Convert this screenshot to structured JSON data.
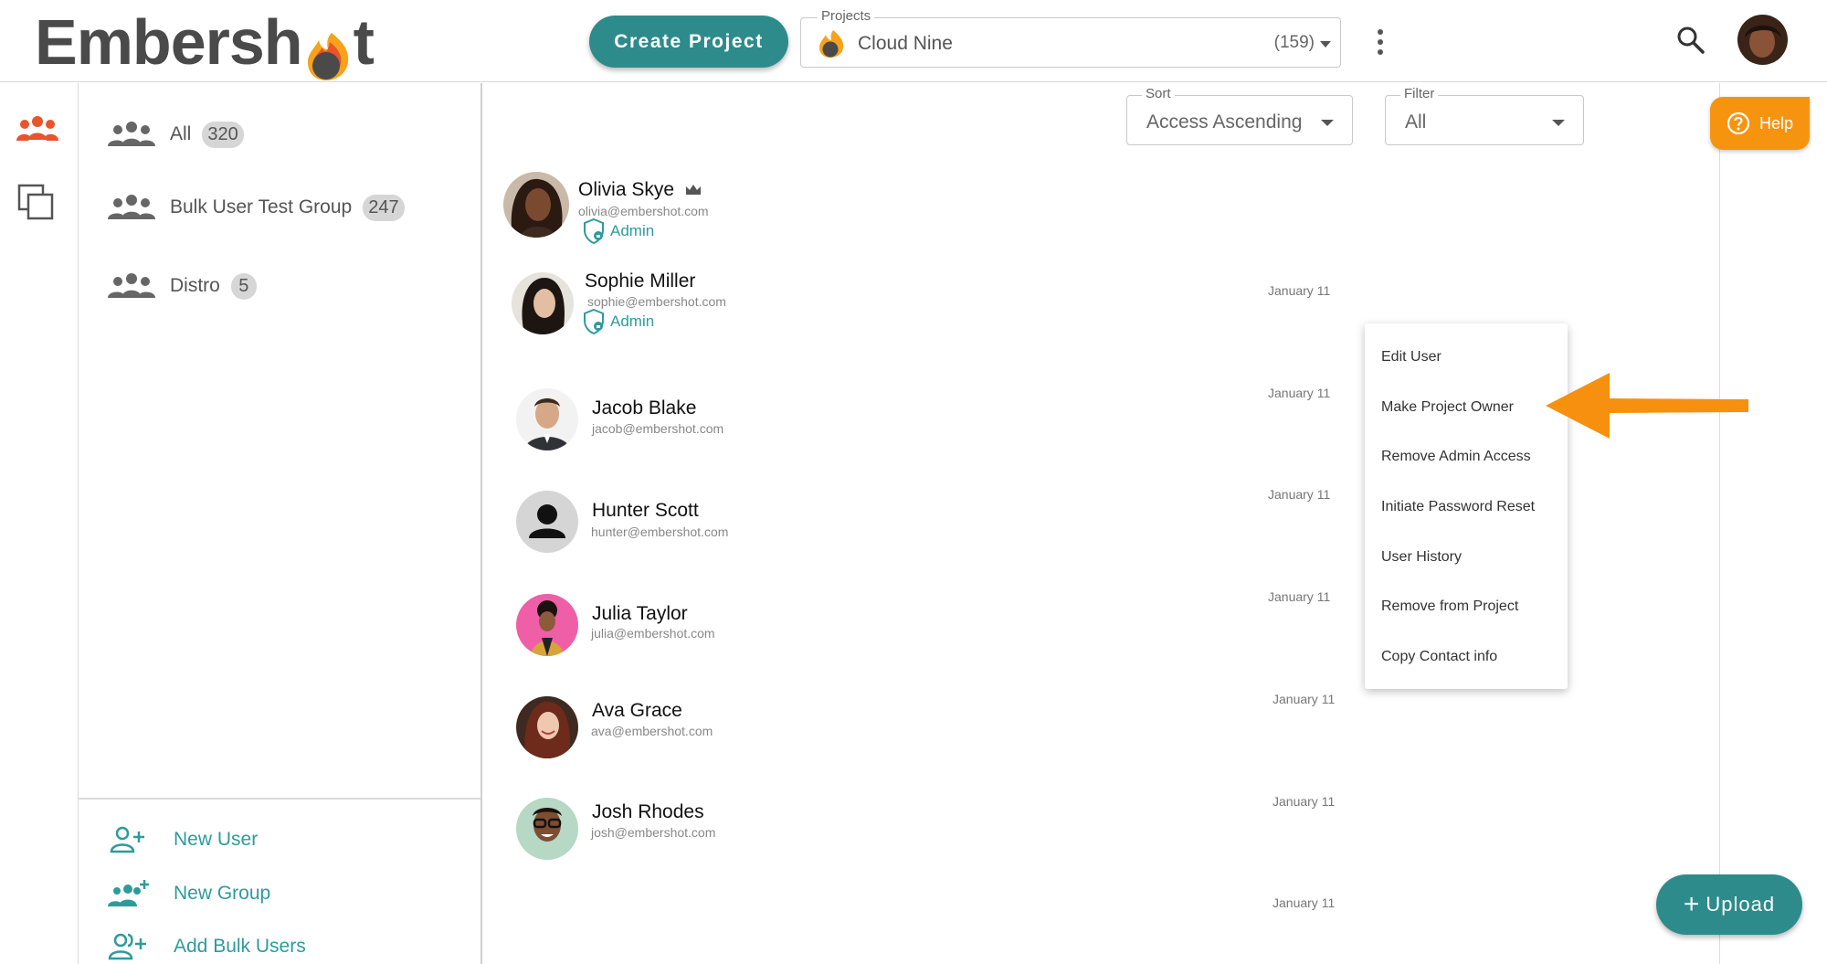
{
  "header": {
    "logo_text_a": "Embersh",
    "logo_text_b": "t",
    "create_label": "Create Project",
    "project": {
      "legend": "Projects",
      "value": "Cloud Nine",
      "count": "(159)"
    }
  },
  "groups": [
    {
      "label": "All",
      "count": "320"
    },
    {
      "label": "Bulk User Test Group",
      "count": "247"
    },
    {
      "label": "Distro",
      "count": "5"
    }
  ],
  "actions": [
    {
      "label": "New User"
    },
    {
      "label": "New Group"
    },
    {
      "label": "Add Bulk Users"
    }
  ],
  "sort": {
    "legend": "Sort",
    "value": "Access Ascending"
  },
  "filter": {
    "legend": "Filter",
    "value": "All"
  },
  "help_label": "Help",
  "users": [
    {
      "name": "Olivia Skye",
      "email": "olivia@embershot.com",
      "role": "Admin",
      "date": "January 11",
      "owner": true
    },
    {
      "name": "Sophie Miller",
      "email": "sophie@embershot.com",
      "role": "Admin",
      "date": "January 11"
    },
    {
      "name": "Jacob Blake",
      "email": "jacob@embershot.com",
      "role": "",
      "date": "January 11"
    },
    {
      "name": "Hunter Scott",
      "email": "hunter@embershot.com",
      "role": "",
      "date": "January 11"
    },
    {
      "name": "Julia Taylor",
      "email": "julia@embershot.com",
      "role": "",
      "date": "January 11"
    },
    {
      "name": "Ava Grace",
      "email": "ava@embershot.com",
      "role": "",
      "date": "January 11"
    },
    {
      "name": "Josh Rhodes",
      "email": "josh@embershot.com",
      "role": "",
      "date": "January 11"
    }
  ],
  "context_menu": [
    "Edit User",
    "Make Project Owner",
    "Remove Admin Access",
    "Initiate Password Reset",
    "User History",
    "Remove from Project",
    "Copy Contact info"
  ],
  "upload_label": "Upload",
  "colors": {
    "teal": "#2e8b8b",
    "accent_orange": "#f7940f",
    "link_teal": "#2e9b9b",
    "brand_red": "#e8542c"
  }
}
